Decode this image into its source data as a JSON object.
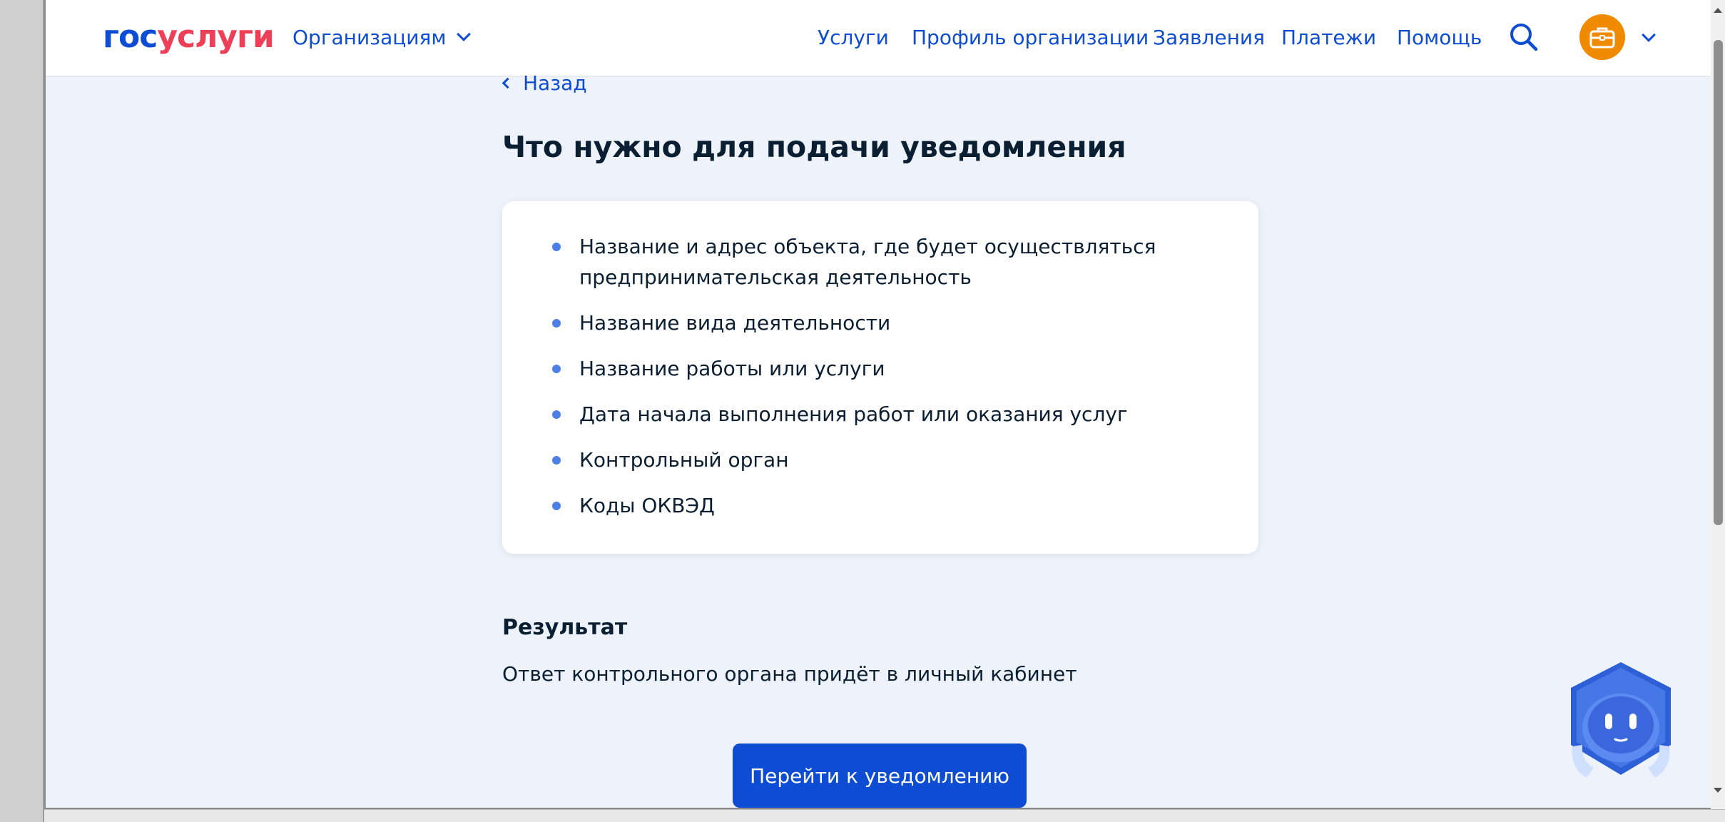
{
  "header": {
    "logo_part1": "гос",
    "logo_part2": "услуги",
    "org_menu_label": "Организациям",
    "nav": [
      {
        "label": "Услуги"
      },
      {
        "label": "Профиль организации"
      },
      {
        "label": "Заявления"
      },
      {
        "label": "Платежи"
      },
      {
        "label": "Помощь"
      }
    ]
  },
  "back_label": "Назад",
  "title": "Что нужно для подачи уведомления",
  "requirements": [
    "Название и адрес объекта, где будет осуществляться предпринимательская деятельность",
    "Название вида деятельности",
    "Название работы или услуги",
    "Дата начала выполнения работ или оказания услуг",
    "Контрольный орган",
    "Коды ОКВЭД"
  ],
  "result": {
    "title": "Результат",
    "text": "Ответ контрольного органа придёт в личный кабинет"
  },
  "cta_label": "Перейти к уведомлению",
  "colors": {
    "brand_blue": "#0d4cd3",
    "brand_red": "#ee3f58",
    "avatar_orange": "#f08a00",
    "page_bg": "#eef3fb"
  },
  "icons": {
    "search": "search-icon",
    "avatar": "briefcase-icon",
    "assistant": "robot-assistant-icon"
  }
}
